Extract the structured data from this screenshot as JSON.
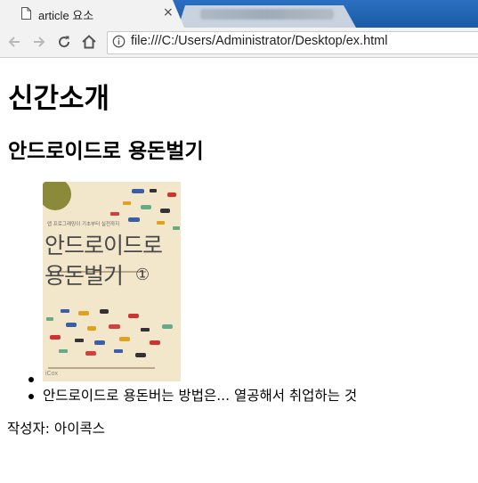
{
  "browser": {
    "tab_title": "article 요소",
    "tab_close": "×",
    "url": "file:///C:/Users/Administrator/Desktop/ex.html",
    "icons": [
      "page-icon",
      "close-icon",
      "back-arrow-icon",
      "forward-arrow-icon",
      "reload-icon",
      "home-icon",
      "info-icon"
    ]
  },
  "page": {
    "heading": "신간소개",
    "book": {
      "title": "안드로이드로 용돈벌기",
      "description": "안드로이드로 용돈버는 방법은... 열공해서 취업하는 것",
      "cover": {
        "title_line1": "안드로이드로",
        "title_line2": "용돈벌기",
        "volume": "①",
        "tagline": "앱 프로그래밍이 기초부터 실전까지",
        "publisher": "iCox"
      }
    },
    "author": "작성자: 아이콕스"
  },
  "colors": {
    "tabstrip": "#1e61b0",
    "chrome": "#f2f2f2",
    "cover_bg": "#f2e6cb"
  }
}
